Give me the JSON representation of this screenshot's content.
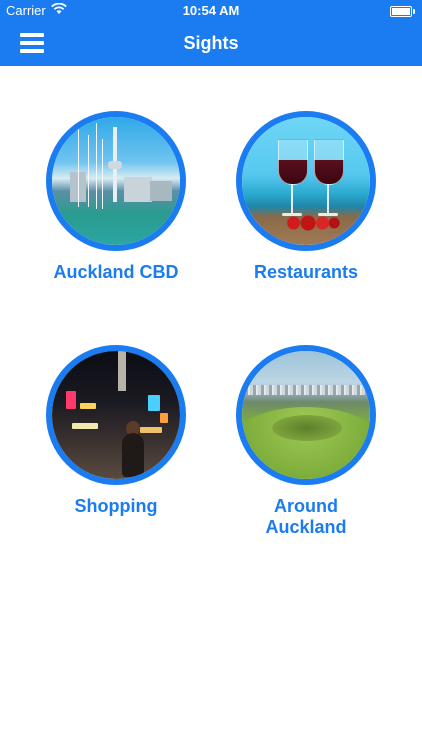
{
  "status_bar": {
    "carrier": "Carrier",
    "wifi_icon": "wifi-icon",
    "time": "10:54 AM",
    "battery_icon": "battery-icon"
  },
  "header": {
    "title": "Sights",
    "menu_icon": "hamburger-menu-icon",
    "background_color": "#1a7cf0"
  },
  "tiles": [
    {
      "label": "Auckland CBD",
      "image": "auckland-cbd-photo"
    },
    {
      "label": "Restaurants",
      "image": "restaurants-photo"
    },
    {
      "label": "Shopping",
      "image": "shopping-photo"
    },
    {
      "label_line1": "Around",
      "label_line2": "Auckland",
      "image": "around-auckland-photo"
    }
  ],
  "colors": {
    "accent": "#1a7cf0",
    "background": "#ffffff"
  }
}
